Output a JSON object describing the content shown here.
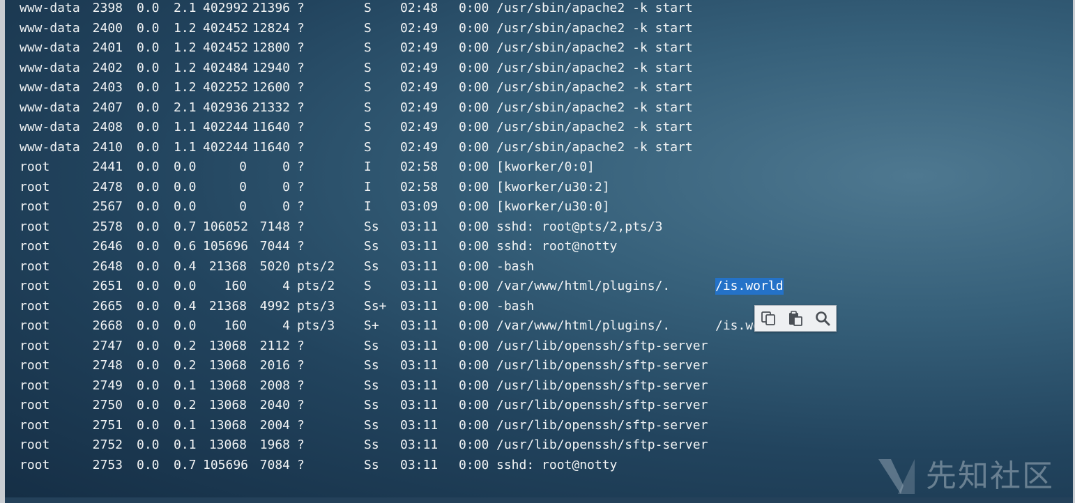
{
  "processes": [
    {
      "user": "www-data",
      "pid": "2398",
      "cpu": "0.0",
      "mem": "2.1",
      "vsz": "402992",
      "rss": "21396",
      "tty": "?",
      "stat": "S",
      "start": "02:48",
      "time": "0:00",
      "cmd": "/usr/sbin/apache2 -k start"
    },
    {
      "user": "www-data",
      "pid": "2400",
      "cpu": "0.0",
      "mem": "1.2",
      "vsz": "402452",
      "rss": "12824",
      "tty": "?",
      "stat": "S",
      "start": "02:49",
      "time": "0:00",
      "cmd": "/usr/sbin/apache2 -k start"
    },
    {
      "user": "www-data",
      "pid": "2401",
      "cpu": "0.0",
      "mem": "1.2",
      "vsz": "402452",
      "rss": "12800",
      "tty": "?",
      "stat": "S",
      "start": "02:49",
      "time": "0:00",
      "cmd": "/usr/sbin/apache2 -k start"
    },
    {
      "user": "www-data",
      "pid": "2402",
      "cpu": "0.0",
      "mem": "1.2",
      "vsz": "402484",
      "rss": "12940",
      "tty": "?",
      "stat": "S",
      "start": "02:49",
      "time": "0:00",
      "cmd": "/usr/sbin/apache2 -k start"
    },
    {
      "user": "www-data",
      "pid": "2403",
      "cpu": "0.0",
      "mem": "1.2",
      "vsz": "402252",
      "rss": "12600",
      "tty": "?",
      "stat": "S",
      "start": "02:49",
      "time": "0:00",
      "cmd": "/usr/sbin/apache2 -k start"
    },
    {
      "user": "www-data",
      "pid": "2407",
      "cpu": "0.0",
      "mem": "2.1",
      "vsz": "402936",
      "rss": "21332",
      "tty": "?",
      "stat": "S",
      "start": "02:49",
      "time": "0:00",
      "cmd": "/usr/sbin/apache2 -k start"
    },
    {
      "user": "www-data",
      "pid": "2408",
      "cpu": "0.0",
      "mem": "1.1",
      "vsz": "402244",
      "rss": "11640",
      "tty": "?",
      "stat": "S",
      "start": "02:49",
      "time": "0:00",
      "cmd": "/usr/sbin/apache2 -k start"
    },
    {
      "user": "www-data",
      "pid": "2410",
      "cpu": "0.0",
      "mem": "1.1",
      "vsz": "402244",
      "rss": "11640",
      "tty": "?",
      "stat": "S",
      "start": "02:49",
      "time": "0:00",
      "cmd": "/usr/sbin/apache2 -k start"
    },
    {
      "user": "root",
      "pid": "2441",
      "cpu": "0.0",
      "mem": "0.0",
      "vsz": "0",
      "rss": "0",
      "tty": "?",
      "stat": "I",
      "start": "02:58",
      "time": "0:00",
      "cmd": "[kworker/0:0]"
    },
    {
      "user": "root",
      "pid": "2478",
      "cpu": "0.0",
      "mem": "0.0",
      "vsz": "0",
      "rss": "0",
      "tty": "?",
      "stat": "I",
      "start": "02:58",
      "time": "0:00",
      "cmd": "[kworker/u30:2]"
    },
    {
      "user": "root",
      "pid": "2567",
      "cpu": "0.0",
      "mem": "0.0",
      "vsz": "0",
      "rss": "0",
      "tty": "?",
      "stat": "I",
      "start": "03:09",
      "time": "0:00",
      "cmd": "[kworker/u30:0]"
    },
    {
      "user": "root",
      "pid": "2578",
      "cpu": "0.0",
      "mem": "0.7",
      "vsz": "106052",
      "rss": "7148",
      "tty": "?",
      "stat": "Ss",
      "start": "03:11",
      "time": "0:00",
      "cmd": "sshd: root@pts/2,pts/3"
    },
    {
      "user": "root",
      "pid": "2646",
      "cpu": "0.0",
      "mem": "0.6",
      "vsz": "105696",
      "rss": "7044",
      "tty": "?",
      "stat": "Ss",
      "start": "03:11",
      "time": "0:00",
      "cmd": "sshd: root@notty"
    },
    {
      "user": "root",
      "pid": "2648",
      "cpu": "0.0",
      "mem": "0.4",
      "vsz": "21368",
      "rss": "5020",
      "tty": "pts/2",
      "stat": "Ss",
      "start": "03:11",
      "time": "0:00",
      "cmd": "-bash"
    },
    {
      "user": "root",
      "pid": "2651",
      "cpu": "0.0",
      "mem": "0.0",
      "vsz": "160",
      "rss": "4",
      "tty": "pts/2",
      "stat": "S",
      "start": "03:11",
      "time": "0:00",
      "cmd": "/var/www/html/plugins/.",
      "cmd2": "/is.world"
    },
    {
      "user": "root",
      "pid": "2665",
      "cpu": "0.0",
      "mem": "0.4",
      "vsz": "21368",
      "rss": "4992",
      "tty": "pts/3",
      "stat": "Ss+",
      "start": "03:11",
      "time": "0:00",
      "cmd": "-bash"
    },
    {
      "user": "root",
      "pid": "2668",
      "cpu": "0.0",
      "mem": "0.0",
      "vsz": "160",
      "rss": "4",
      "tty": "pts/3",
      "stat": "S+",
      "start": "03:11",
      "time": "0:00",
      "cmd": "/var/www/html/plugins/.",
      "cmd2": "/is.wo"
    },
    {
      "user": "root",
      "pid": "2747",
      "cpu": "0.0",
      "mem": "0.2",
      "vsz": "13068",
      "rss": "2112",
      "tty": "?",
      "stat": "Ss",
      "start": "03:11",
      "time": "0:00",
      "cmd": "/usr/lib/openssh/sftp-server"
    },
    {
      "user": "root",
      "pid": "2748",
      "cpu": "0.0",
      "mem": "0.2",
      "vsz": "13068",
      "rss": "2016",
      "tty": "?",
      "stat": "Ss",
      "start": "03:11",
      "time": "0:00",
      "cmd": "/usr/lib/openssh/sftp-server"
    },
    {
      "user": "root",
      "pid": "2749",
      "cpu": "0.0",
      "mem": "0.1",
      "vsz": "13068",
      "rss": "2008",
      "tty": "?",
      "stat": "Ss",
      "start": "03:11",
      "time": "0:00",
      "cmd": "/usr/lib/openssh/sftp-server"
    },
    {
      "user": "root",
      "pid": "2750",
      "cpu": "0.0",
      "mem": "0.2",
      "vsz": "13068",
      "rss": "2040",
      "tty": "?",
      "stat": "Ss",
      "start": "03:11",
      "time": "0:00",
      "cmd": "/usr/lib/openssh/sftp-server"
    },
    {
      "user": "root",
      "pid": "2751",
      "cpu": "0.0",
      "mem": "0.1",
      "vsz": "13068",
      "rss": "2004",
      "tty": "?",
      "stat": "Ss",
      "start": "03:11",
      "time": "0:00",
      "cmd": "/usr/lib/openssh/sftp-server"
    },
    {
      "user": "root",
      "pid": "2752",
      "cpu": "0.0",
      "mem": "0.1",
      "vsz": "13068",
      "rss": "1968",
      "tty": "?",
      "stat": "Ss",
      "start": "03:11",
      "time": "0:00",
      "cmd": "/usr/lib/openssh/sftp-server"
    },
    {
      "user": "root",
      "pid": "2753",
      "cpu": "0.0",
      "mem": "0.7",
      "vsz": "105696",
      "rss": "7084",
      "tty": "?",
      "stat": "Ss",
      "start": "03:11",
      "time": "0:00",
      "cmd": "sshd: root@notty"
    }
  ],
  "selection": {
    "row": 14,
    "text": "/is.world"
  },
  "popup": {
    "icons": [
      "copy-icon",
      "paste-icon",
      "search-icon"
    ]
  },
  "watermark": {
    "text": "先知社区"
  },
  "colors": {
    "terminal_text": "#f2f4f5",
    "selection_bg": "#2472c8",
    "background_dark": "#152e45",
    "background_light": "#4e7890"
  }
}
